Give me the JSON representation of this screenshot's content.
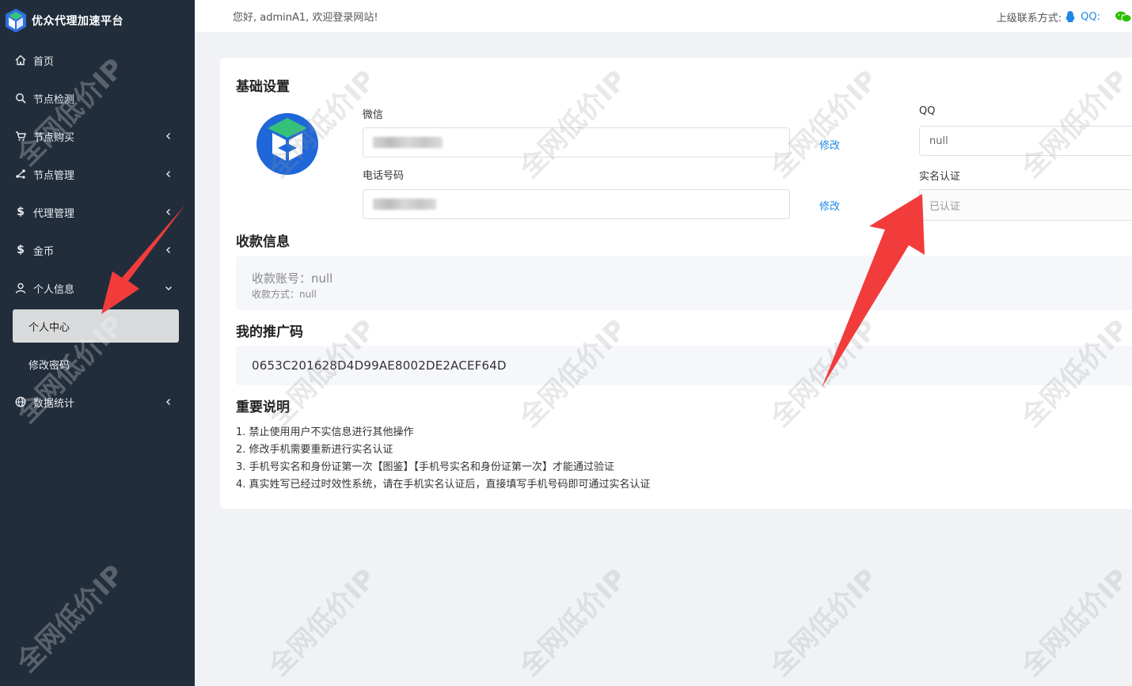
{
  "brand": {
    "title": "优众代理加速平台",
    "icon": "brand-cube-icon"
  },
  "sidebar": {
    "items": [
      {
        "label": "首页",
        "icon": "home-icon",
        "arrow": ""
      },
      {
        "label": "节点检测",
        "icon": "search-icon",
        "arrow": ""
      },
      {
        "label": "节点购买",
        "icon": "cart-icon",
        "arrow": "left"
      },
      {
        "label": "节点管理",
        "icon": "node-icon",
        "arrow": "left"
      },
      {
        "label": "代理管理",
        "icon": "dollar-icon",
        "arrow": "left"
      },
      {
        "label": "金币",
        "icon": "dollar-icon",
        "arrow": "left"
      },
      {
        "label": "个人信息",
        "icon": "user-icon",
        "arrow": "down"
      }
    ],
    "submenu": [
      {
        "label": "个人中心",
        "active": true
      },
      {
        "label": "修改密码",
        "active": false
      }
    ],
    "last_item": {
      "label": "数据统计",
      "icon": "globe-icon",
      "arrow": "left"
    }
  },
  "topbar": {
    "greeting": "您好, adminA1, 欢迎登录网站!",
    "contact_label": "上级联系方式:",
    "qq_label": "QQ:"
  },
  "basic": {
    "title": "基础设置",
    "wechat_label": "微信",
    "phone_label": "电话号码",
    "edit_label": "修改",
    "qq_label": "QQ",
    "qq_value": "null",
    "realname_label": "实名认证",
    "realname_value": "已认证"
  },
  "payment": {
    "title": "收款信息",
    "account": "收款账号：null",
    "method": "收款方式：null"
  },
  "promo": {
    "title": "我的推广码",
    "code": "0653C201628D4D99AE8002DE2ACEF64D"
  },
  "notes": {
    "title": "重要说明",
    "items": [
      "1. 禁止使用用户不实信息进行其他操作",
      "2. 修改手机需要重新进行实名认证",
      "3. 手机号实名和身份证第一次【图鉴】【手机号实名和身份证第一次】才能通过验证",
      "4. 真实姓写已经过时效性系统，请在手机实名认证后，直接填写手机号码即可通过实名认证"
    ]
  },
  "watermark": {
    "text": "全网低价IP"
  },
  "colors": {
    "sidebar_bg": "#222d3b",
    "accent": "#1e88e5",
    "arrow_red": "#f23c3c"
  }
}
